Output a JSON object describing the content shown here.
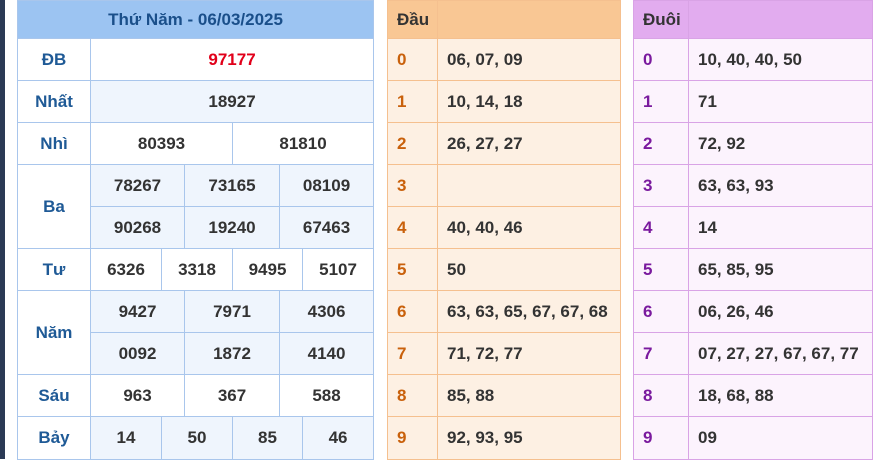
{
  "result": {
    "title": "Thứ Năm - 06/03/2025",
    "db_label": "ĐB",
    "db_value": "97177",
    "nhat_label": "Nhất",
    "nhat_value": "18927",
    "nhi_label": "Nhì",
    "nhi_values": [
      "80393",
      "81810"
    ],
    "ba_label": "Ba",
    "ba_values": [
      "78267",
      "73165",
      "08109",
      "90268",
      "19240",
      "67463"
    ],
    "tu_label": "Tư",
    "tu_values": [
      "6326",
      "3318",
      "9495",
      "5107"
    ],
    "nam_label": "Năm",
    "nam_values": [
      "9427",
      "7971",
      "4306",
      "0092",
      "1872",
      "4140"
    ],
    "sau_label": "Sáu",
    "sau_values": [
      "963",
      "367",
      "588"
    ],
    "bay_label": "Bảy",
    "bay_values": [
      "14",
      "50",
      "85",
      "46"
    ]
  },
  "dau": {
    "header": "Đầu",
    "header_value": "",
    "rows": [
      {
        "digit": "0",
        "values": "06, 07, 09"
      },
      {
        "digit": "1",
        "values": "10, 14, 18"
      },
      {
        "digit": "2",
        "values": "26, 27, 27"
      },
      {
        "digit": "3",
        "values": ""
      },
      {
        "digit": "4",
        "values": "40, 40, 46"
      },
      {
        "digit": "5",
        "values": "50"
      },
      {
        "digit": "6",
        "values": "63, 63, 65, 67, 67, 68"
      },
      {
        "digit": "7",
        "values": "71, 72, 77"
      },
      {
        "digit": "8",
        "values": "85, 88"
      },
      {
        "digit": "9",
        "values": "92, 93, 95"
      }
    ]
  },
  "duoi": {
    "header": "Đuôi",
    "header_value": "",
    "rows": [
      {
        "digit": "0",
        "values": "10, 40, 40, 50"
      },
      {
        "digit": "1",
        "values": "71"
      },
      {
        "digit": "2",
        "values": "72, 92"
      },
      {
        "digit": "3",
        "values": "63, 63, 93"
      },
      {
        "digit": "4",
        "values": "14"
      },
      {
        "digit": "5",
        "values": "65, 85, 95"
      },
      {
        "digit": "6",
        "values": "06, 26, 46"
      },
      {
        "digit": "7",
        "values": "07, 27, 27, 67, 67, 77"
      },
      {
        "digit": "8",
        "values": "18, 68, 88"
      },
      {
        "digit": "9",
        "values": "09"
      }
    ]
  },
  "colors": {
    "special_prize": "#e1001a",
    "label_blue": "#1f5a96",
    "dau_digit": "#c9610c",
    "duoi_digit": "#7a1a9e"
  }
}
